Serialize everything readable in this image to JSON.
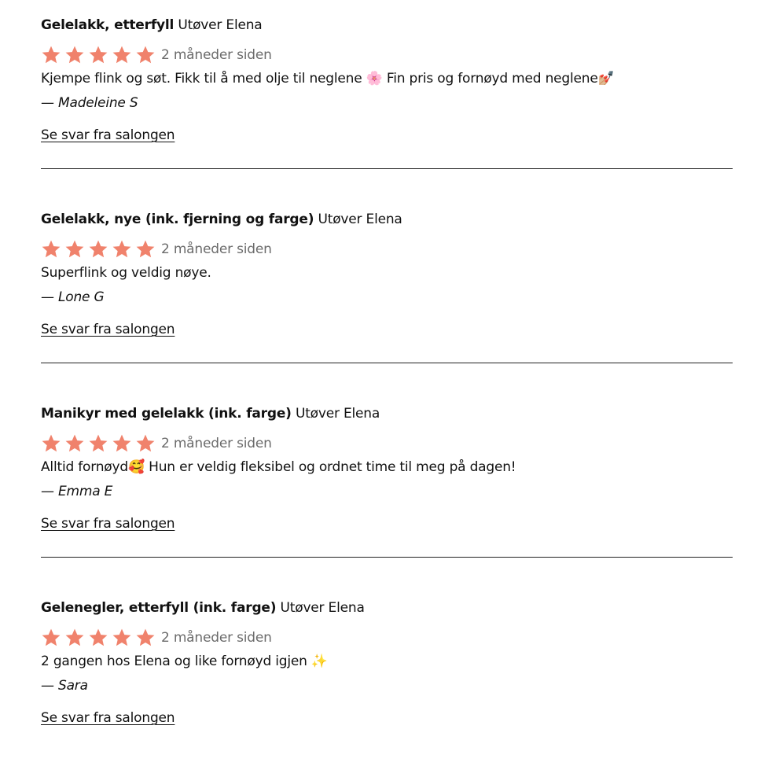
{
  "colors": {
    "star": "#f0826c",
    "text": "#111111",
    "muted": "#6b6b6b",
    "divider": "#222222"
  },
  "reviews": [
    {
      "service": "Gelelakk, etterfyll",
      "performer": "Utøver Elena",
      "rating": 5,
      "date": "2 måneder siden",
      "text": "Kjempe flink og søt. Fikk til å med olje til neglene 🌸 Fin pris og fornøyd med neglene💅🏼",
      "author": "— Madeleine S",
      "reply_link": "Se svar fra salongen"
    },
    {
      "service": "Gelelakk, nye (ink. fjerning og farge)",
      "performer": "Utøver Elena",
      "rating": 5,
      "date": "2 måneder siden",
      "text": "Superflink og veldig nøye.",
      "author": "— Lone G",
      "reply_link": "Se svar fra salongen"
    },
    {
      "service": "Manikyr med gelelakk (ink. farge)",
      "performer": "Utøver Elena",
      "rating": 5,
      "date": "2 måneder siden",
      "text": "Alltid fornøyd🥰 Hun er veldig fleksibel og ordnet time til meg på dagen!",
      "author": "— Emma E",
      "reply_link": "Se svar fra salongen"
    },
    {
      "service": "Gelenegler, etterfyll (ink. farge)",
      "performer": "Utøver Elena",
      "rating": 5,
      "date": "2 måneder siden",
      "text": "2 gangen hos Elena og like fornøyd igjen ✨",
      "author": "— Sara",
      "reply_link": "Se svar fra salongen"
    }
  ]
}
